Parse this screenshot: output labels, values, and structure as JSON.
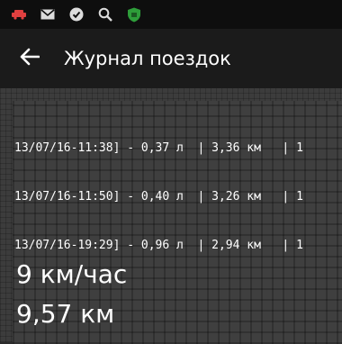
{
  "status_bar": {
    "icons": [
      "car-icon",
      "mail-icon",
      "check-circle-icon",
      "search-icon",
      "shield-icon"
    ],
    "colors": {
      "car": "#e04040",
      "shield": "#2e9e3a"
    }
  },
  "app_bar": {
    "back_icon": "arrow-left-icon",
    "title": "Журнал поездок"
  },
  "log": {
    "lines": [
      "13/07/16-11:38] - 0,37 л  | 3,36 км   | 1",
      "13/07/16-11:50] - 0,40 л  | 3,26 км   | 1",
      "13/07/16-19:29] - 0,96 л  | 2,94 км   | 1"
    ]
  },
  "stats": {
    "speed": "9 км/час",
    "distance": "9,57 км"
  }
}
